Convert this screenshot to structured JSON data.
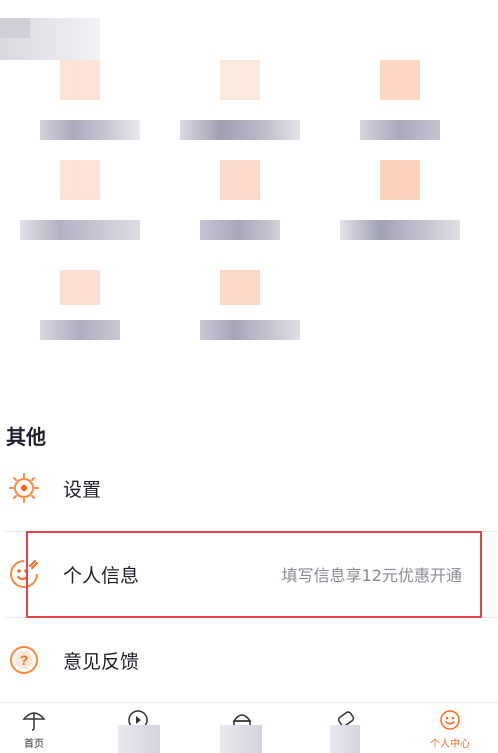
{
  "others": {
    "section_title": "其他",
    "items": [
      {
        "label": "设置",
        "hint": ""
      },
      {
        "label": "个人信息",
        "hint": "填写信息享12元优惠开通"
      },
      {
        "label": "意见反馈",
        "hint": ""
      }
    ]
  },
  "tabbar": {
    "tabs": [
      {
        "label": "首页",
        "icon": "umbrella-icon"
      },
      {
        "label": "",
        "icon": "video-icon"
      },
      {
        "label": "",
        "icon": "vip-icon"
      },
      {
        "label": "",
        "icon": "ticket-icon"
      },
      {
        "label": "个人中心",
        "icon": "smile-icon",
        "active": true
      }
    ]
  },
  "colors": {
    "accent": "#ff6a1a",
    "highlight": "#e8434b",
    "text": "#1f1f2e",
    "hint": "#8a8a99"
  }
}
